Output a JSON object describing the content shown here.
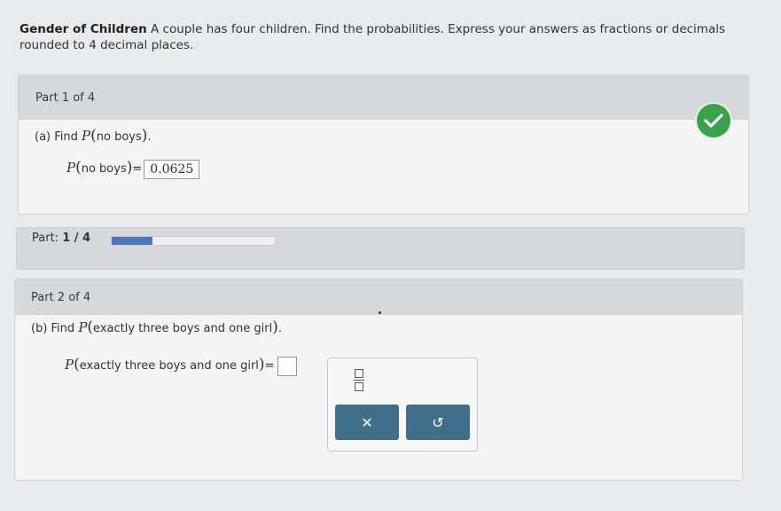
{
  "question": {
    "title": "Gender of Children",
    "text": "A couple has four children. Find the probabilities. Express your answers as fractions or decimals rounded to 4 decimal places."
  },
  "part1": {
    "header": "Part 1 of 4",
    "prompt_prefix": "(a) Find",
    "prob_symbol": "P",
    "event": "no boys",
    "answer_label_event": "no boys",
    "answer_value": "0.0625",
    "status": "correct"
  },
  "progress": {
    "label_prefix": "Part:",
    "label_value": "1 / 4",
    "fraction": 0.25
  },
  "part2": {
    "header": "Part 2 of 4",
    "prompt_prefix": "(b) Find",
    "prob_symbol": "P",
    "event": "exactly three boys and one girl",
    "answer_label_event": "exactly three boys and one girl",
    "answer_value": ""
  },
  "keypad": {
    "fraction_button": "fraction-template",
    "clear_button_label": "✕",
    "undo_button_label": "↺"
  },
  "colors": {
    "correct_green": "#3aa14a",
    "button_teal": "#3f6f89",
    "progress_blue": "#4a78b8"
  }
}
